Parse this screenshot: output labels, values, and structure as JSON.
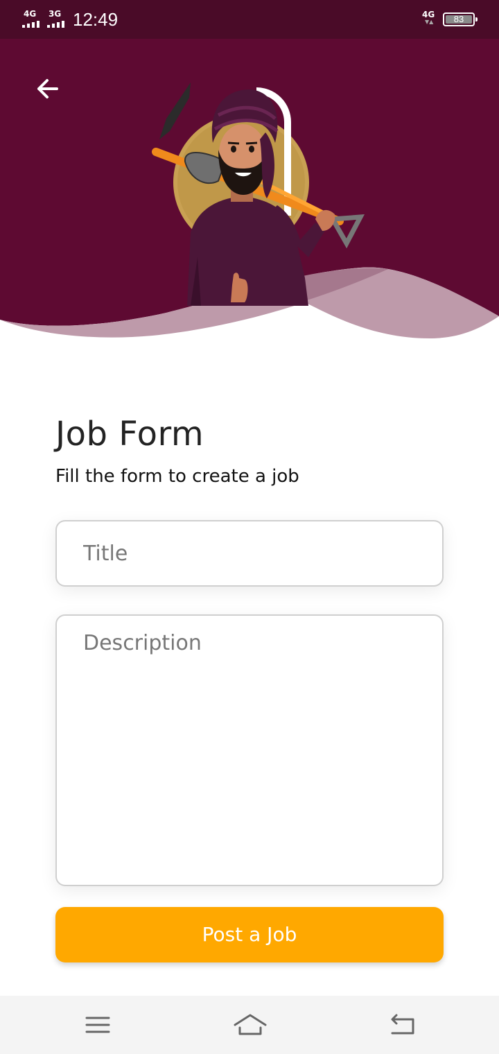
{
  "status_bar": {
    "sim1_type": "4G",
    "sim2_type": "3G",
    "time": "12:49",
    "data_type": "4G",
    "battery_level": "83"
  },
  "header": {
    "background_color": "#5e0a32",
    "wave_color": "#be9aaa",
    "back_icon": "arrow-left-icon",
    "illustration": "worker-with-pickaxe-illustration"
  },
  "form": {
    "title": "Job Form",
    "subtitle": "Fill the form to create a job",
    "title_placeholder": "Title",
    "title_value": "",
    "description_placeholder": "Description",
    "description_value": "",
    "submit_label": "Post a Job",
    "submit_color": "#ffa800"
  },
  "nav_bar": {
    "menu_icon": "menu-icon",
    "home_icon": "home-icon",
    "back_icon": "back-icon"
  }
}
